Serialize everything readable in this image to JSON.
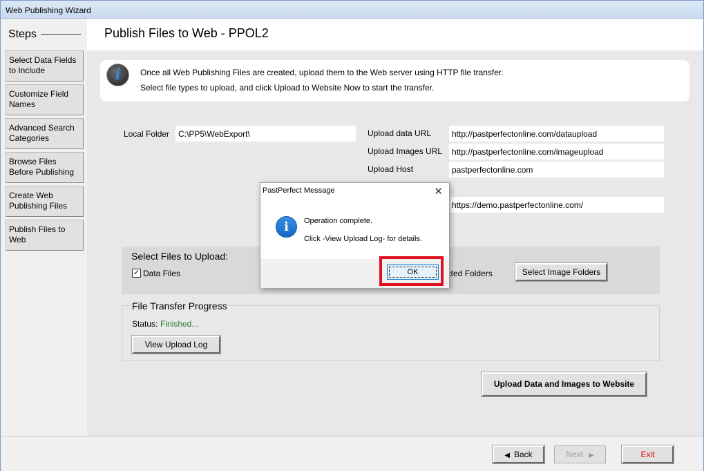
{
  "window": {
    "title": "Web Publishing Wizard"
  },
  "sidebar": {
    "title": "Steps",
    "items": [
      {
        "label": "Select Data Fields to Include"
      },
      {
        "label": "Customize Field Names"
      },
      {
        "label": "Advanced Search Categories"
      },
      {
        "label": "Browse Files Before Publishing"
      },
      {
        "label": "Create Web Publishing Files"
      },
      {
        "label": "Publish Files to Web"
      }
    ]
  },
  "page": {
    "title": "Publish Files to Web - PPOL2"
  },
  "info": {
    "line1": "Once all Web Publishing Files are created, upload them to the Web server using HTTP file transfer.",
    "line2": "Select file types to upload, and click Upload to Website Now to start the transfer."
  },
  "form": {
    "local_folder_label": "Local Folder",
    "local_folder_value": "C:\\PP5\\WebExport\\",
    "upload_data_url_label": "Upload data URL",
    "upload_data_url_value": "http://pastperfectonline.com/dataupload",
    "upload_images_url_label": "Upload Images URL",
    "upload_images_url_value": "http://pastperfectonline.com/imageupload",
    "upload_host_label": "Upload Host",
    "upload_host_value": "pastperfectonline.com",
    "site_url_value": "https://demo.pastperfectonline.com/"
  },
  "upload": {
    "title": "Select Files to Upload:",
    "data_files_label": "Data Files",
    "data_files_checked": true,
    "selected_folders_partial": "ected Folders",
    "select_image_folders_label": "Select Image Folders"
  },
  "progress": {
    "title": "File Transfer Progress",
    "status_label": "Status:",
    "status_value": "Finished...",
    "view_log_label": "View Upload Log"
  },
  "actions": {
    "upload_now_label": "Upload Data and Images to Website"
  },
  "footer": {
    "back_label": "Back",
    "next_label": "Next",
    "exit_label": "Exit"
  },
  "dialog": {
    "title": "PastPerfect Message",
    "close": "✕",
    "message1": "Operation complete.",
    "message2": "Click -View Upload Log- for details.",
    "ok_label": "OK"
  },
  "colors": {
    "status_finished": "#2a7a2a",
    "exit_text": "#e00000",
    "highlight": "#e01020"
  }
}
